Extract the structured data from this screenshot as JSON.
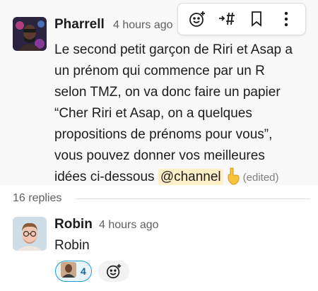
{
  "message": {
    "author": "Pharrell",
    "time": "4 hours ago",
    "lines": [
      "Le second petit garçon de Riri et Asap a",
      "un prénom qui commence par un R",
      "selon TMZ, on va donc faire un papier",
      "“Cher Riri et Asap, on a quelques",
      "propositions de prénoms pour vous”,",
      "vous pouvez donner vos meilleures",
      "idées ci-dessous"
    ],
    "mention": "@channel",
    "emoji": "point-down-emoji",
    "edited": "(edited)"
  },
  "toolbar": {
    "icons": [
      "add-reaction-icon",
      "forward-to-channel-icon",
      "bookmark-icon",
      "more-actions-icon"
    ]
  },
  "thread": {
    "replies_label": "16 replies"
  },
  "reply": {
    "author": "Robin",
    "time": "4 hours ago",
    "text": "Robin",
    "reaction_count": "4"
  },
  "colors": {
    "accent": "#1d9bd1",
    "mention_bg": "#fdf0c9",
    "hover_bg": "#f8f8f8"
  }
}
